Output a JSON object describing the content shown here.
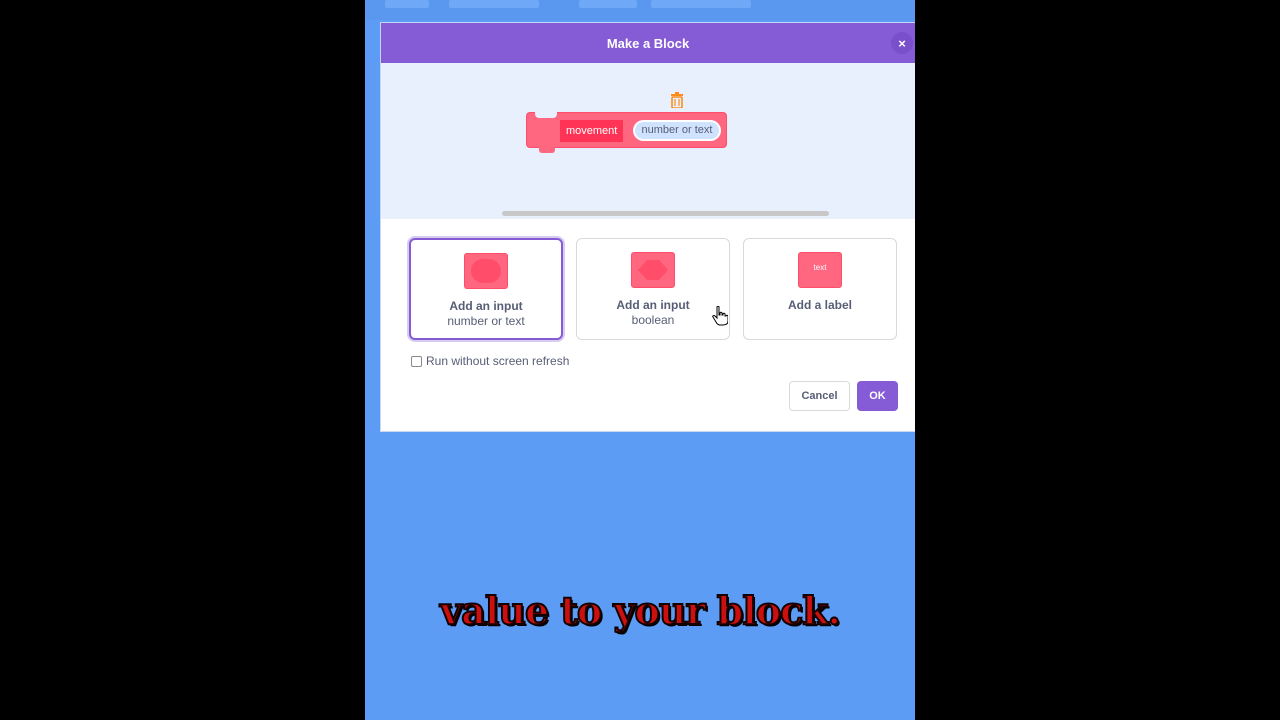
{
  "dialog": {
    "title": "Make a Block",
    "close_label": "×"
  },
  "preview": {
    "block_label": "movement",
    "block_input": "number or text",
    "trash_icon": "trash-icon"
  },
  "options": [
    {
      "title": "Add an input",
      "subtitle": "number or text",
      "icon": "round-input-icon",
      "selected": true
    },
    {
      "title": "Add an input",
      "subtitle": "boolean",
      "icon": "hexagon-input-icon",
      "selected": false
    },
    {
      "title": "Add a label",
      "subtitle": "",
      "icon": "label-icon",
      "icon_text": "text",
      "selected": false
    }
  ],
  "refresh": {
    "label": "Run without screen refresh",
    "checked": false
  },
  "buttons": {
    "cancel": "Cancel",
    "ok": "OK"
  },
  "caption": "value to your block.",
  "colors": {
    "header": "#855cd6",
    "block": "#ff6680",
    "stage": "#5c9cf4",
    "caption": "#cc1010"
  }
}
